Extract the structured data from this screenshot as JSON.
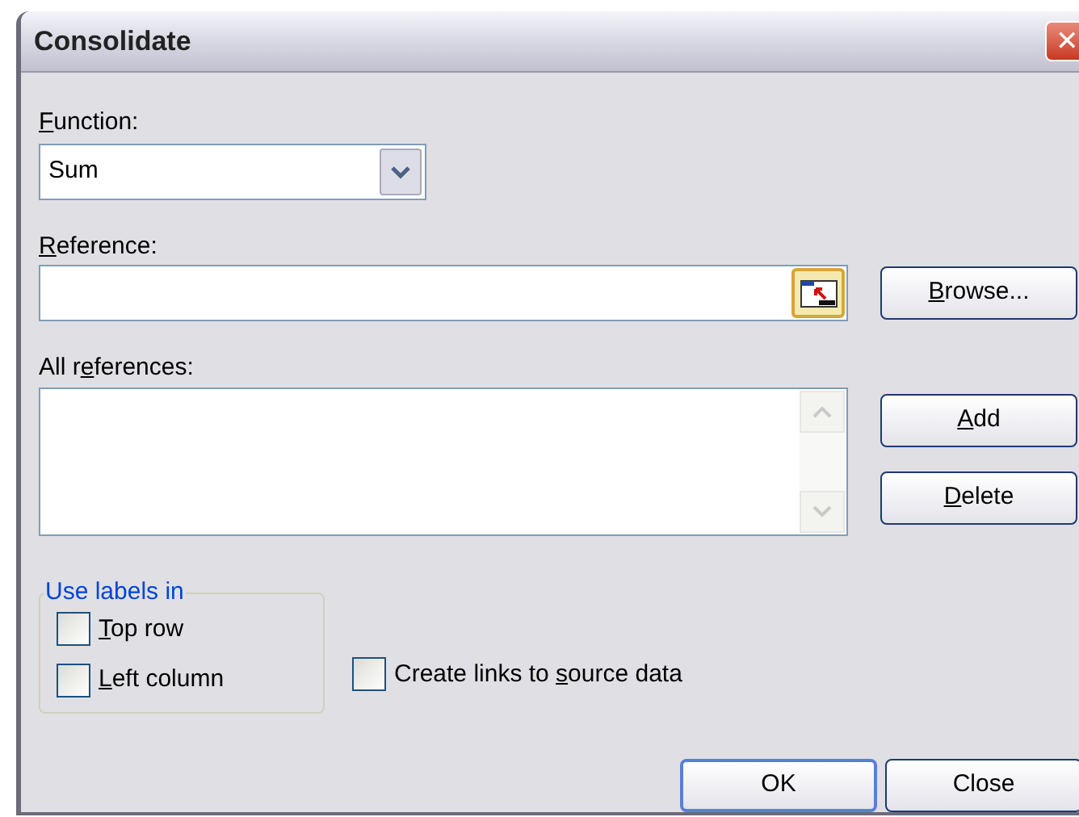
{
  "window": {
    "title": "Consolidate",
    "close_label": "✕"
  },
  "function": {
    "label": {
      "key": "F",
      "post": "unction:"
    },
    "value": "Sum"
  },
  "reference": {
    "label": {
      "key": "R",
      "post": "eference:"
    }
  },
  "all_references": {
    "label": {
      "pre": "All r",
      "key": "e",
      "post": "ferences:"
    }
  },
  "side_buttons": [
    {
      "key": "B",
      "post": "rowse..."
    },
    {
      "key": "A",
      "post": "dd"
    },
    {
      "key": "D",
      "post": "elete"
    }
  ],
  "use_labels": {
    "legend": "Use labels in",
    "options": [
      {
        "label": {
          "key": "T",
          "post": "op row"
        },
        "checked": false
      },
      {
        "label": {
          "key": "L",
          "post": "eft column"
        },
        "checked": false
      }
    ]
  },
  "create_links": {
    "label": {
      "pre": "Create links to ",
      "key": "s",
      "post": "ource data"
    },
    "checked": false
  },
  "buttons": [
    {
      "label": "OK",
      "default": true
    },
    {
      "label": "Close",
      "default": false
    }
  ]
}
